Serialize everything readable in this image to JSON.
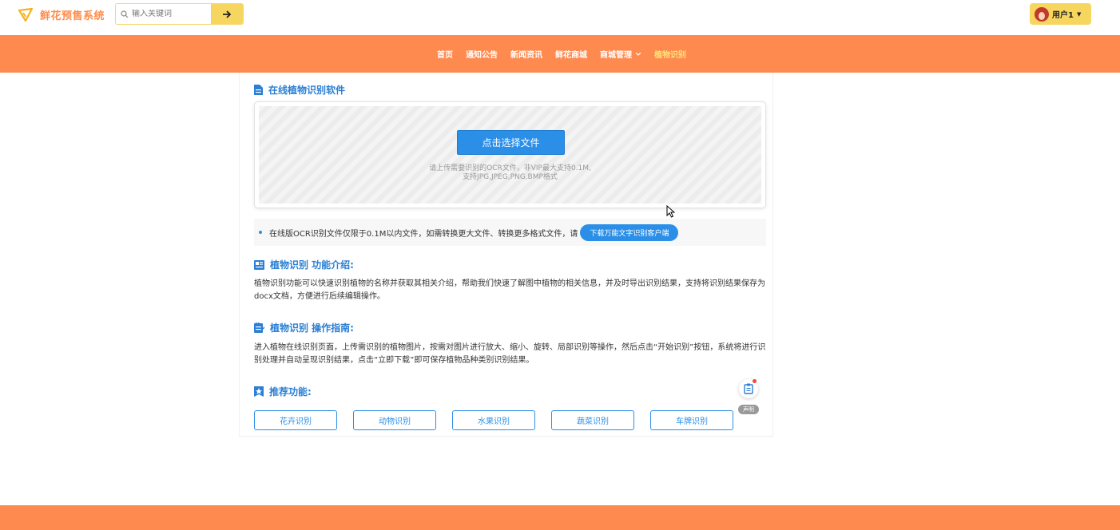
{
  "header": {
    "site_title": "鲜花预售系统",
    "search_placeholder": "输入关键词",
    "user_name": "用户1"
  },
  "nav": {
    "items": [
      {
        "label": "首页"
      },
      {
        "label": "通知公告"
      },
      {
        "label": "新闻资讯"
      },
      {
        "label": "鲜花商城"
      },
      {
        "label": "商城管理",
        "has_dropdown": true
      },
      {
        "label": "植物识别",
        "active": true
      }
    ]
  },
  "main": {
    "title": "在线植物识别软件",
    "upload": {
      "button_label": "点击选择文件",
      "hint_line1": "请上传需要识别的OCR文件，非VIP最大支持0.1M,",
      "hint_line2": "支持JPG,JPEG,PNG,BMP格式"
    },
    "notice": {
      "text": "在线版OCR识别文件仅限于0.1M以内文件，如需转换更大文件、转换更多格式文件，请",
      "button_label": "下载万能文字识别客户端"
    },
    "intro": {
      "title": "植物识别 功能介绍:",
      "text": "植物识别功能可以快速识别植物的名称并获取其相关介绍，帮助我们快速了解图中植物的相关信息，并及时导出识别结果，支持将识别结果保存为docx文档，方便进行后续编辑操作。"
    },
    "guide": {
      "title": "植物识别 操作指南:",
      "text": "进入植物在线识别页面，上传需识别的植物图片，按需对图片进行放大、缩小、旋转、局部识别等操作，然后点击“开始识别”按钮，系统将进行识别处理并自动呈现识别结果，点击“立即下载”即可保存植物品种类别识别结果。"
    },
    "recommend": {
      "title": "推荐功能:",
      "items": [
        "花卉识别",
        "动物识别",
        "水果识别",
        "蔬菜识别",
        "车牌识别"
      ]
    }
  },
  "float": {
    "tag_label": "声明"
  },
  "colors": {
    "brand_orange": "#ff8a4f",
    "accent_yellow": "#f7d660",
    "primary_blue": "#2b8fe8"
  }
}
